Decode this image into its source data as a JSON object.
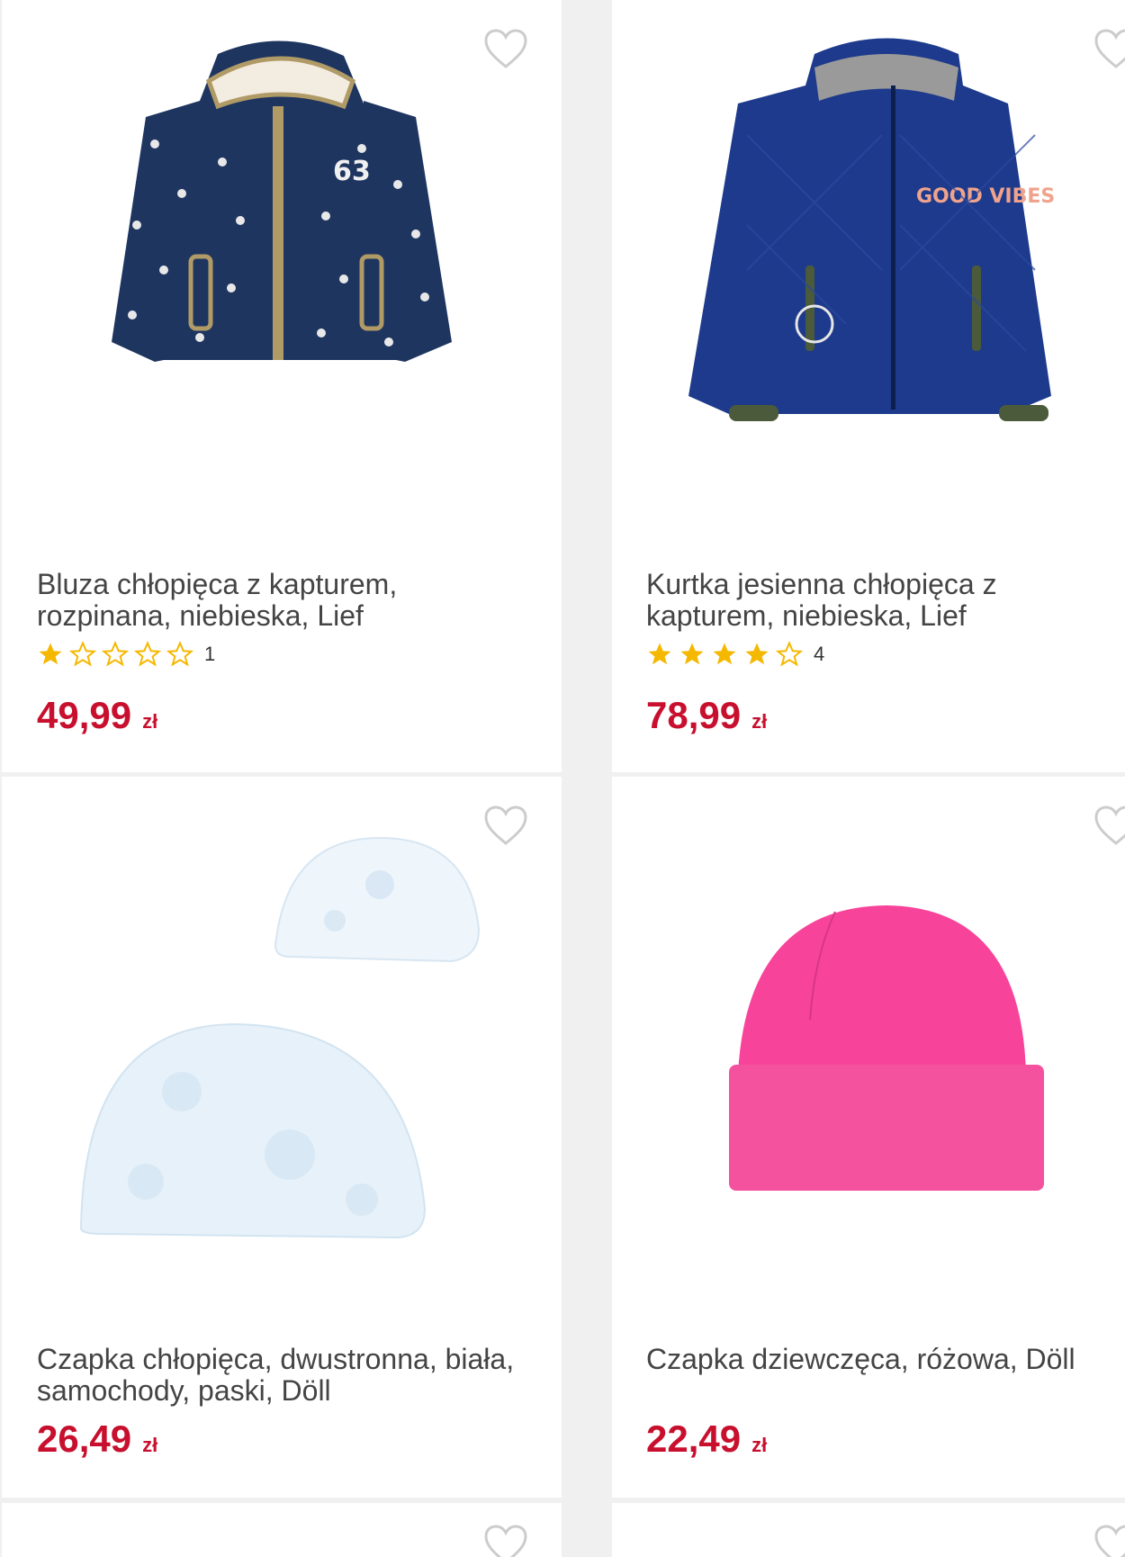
{
  "products": [
    {
      "title": "Bluza chłopięca z kapturem, rozpinana, niebieska, Lief",
      "rating": 1,
      "rating_max": 5,
      "rating_count": "1",
      "price": "49,99",
      "currency": "zł",
      "image": "navy-star-hoodie"
    },
    {
      "title": "Kurtka jesienna chłopięca z kapturem, niebieska, Lief",
      "rating": 4,
      "rating_max": 5,
      "rating_count": "4",
      "price": "78,99",
      "currency": "zł",
      "image": "navy-puffer-jacket",
      "badge_text": "GOOD VIBES"
    },
    {
      "title": "Czapka chłopięca, dwustronna, biała, samochody, paski, Döll",
      "price": "26,49",
      "currency": "zł",
      "image": "white-slouch-beanies"
    },
    {
      "title": "Czapka dziewczęca, różowa, Döll",
      "price": "22,49",
      "currency": "zł",
      "image": "pink-beanie"
    }
  ],
  "colors": {
    "price": "#c8102e",
    "star": "#f5b800",
    "background": "#f0f0f0",
    "card": "#ffffff"
  },
  "icons": {
    "favorite": "heart-outline-icon",
    "star_filled": "star-filled-icon",
    "star_empty": "star-outline-icon"
  }
}
